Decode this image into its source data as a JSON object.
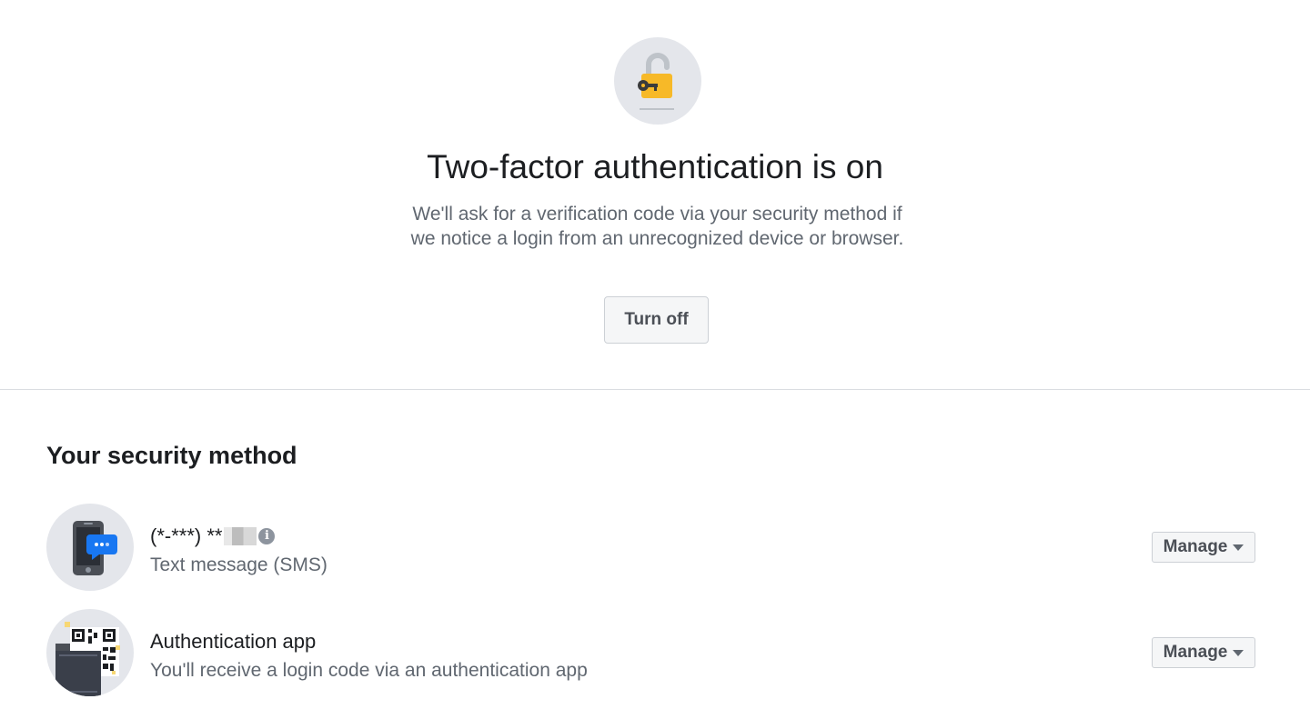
{
  "hero": {
    "icon": "unlocked-padlock-key-icon",
    "title": "Two-factor authentication is on",
    "description": "We'll ask for a verification code via your security method if we notice a login from an unrecognized device or browser.",
    "turn_off_label": "Turn off"
  },
  "section": {
    "title": "Your security method"
  },
  "methods": [
    {
      "icon": "phone-sms-icon",
      "title": "(*-***) **",
      "title_redacted": true,
      "info_icon": "info-icon",
      "subtitle": "Text message (SMS)",
      "manage_label": "Manage"
    },
    {
      "icon": "qr-code-app-icon",
      "title": "Authentication app",
      "subtitle": "You'll receive a login code via an authentication app",
      "manage_label": "Manage"
    }
  ],
  "colors": {
    "icon_circle": "#e4e6eb",
    "lock_yellow": "#f7b928",
    "sms_bubble": "#1877f2",
    "button_bg": "#f5f6f7",
    "button_text": "#4b4f56",
    "secondary_text": "#606770"
  }
}
